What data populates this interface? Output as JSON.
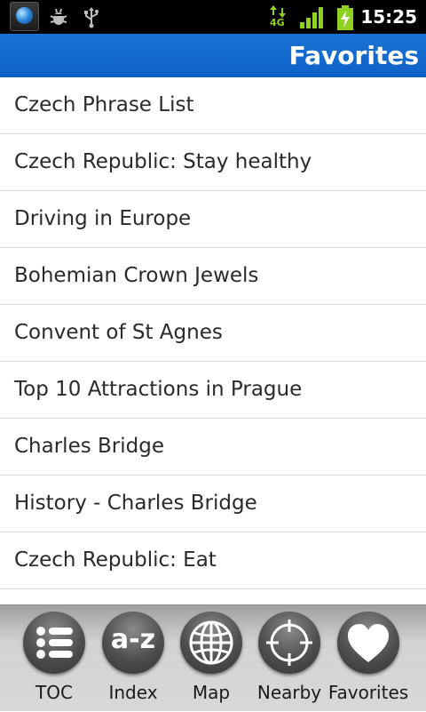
{
  "status_bar": {
    "time": "15:25",
    "network_type": "4G",
    "icons": [
      "app-globe-icon",
      "debug-bug-icon",
      "usb-icon",
      "data-transfer-icon",
      "signal-strength-icon",
      "battery-charging-icon"
    ]
  },
  "header": {
    "title": "Favorites"
  },
  "favorites": [
    {
      "label": "Czech Phrase List"
    },
    {
      "label": "Czech Republic: Stay healthy"
    },
    {
      "label": "Driving in Europe"
    },
    {
      "label": "Bohemian Crown Jewels"
    },
    {
      "label": "Convent of St Agnes"
    },
    {
      "label": "Top 10 Attractions in Prague"
    },
    {
      "label": "Charles Bridge"
    },
    {
      "label": "History - Charles Bridge"
    },
    {
      "label": "Czech Republic: Eat"
    }
  ],
  "toolbar": {
    "items": [
      {
        "label": "TOC",
        "icon": "list-icon"
      },
      {
        "label": "Index",
        "icon": "a-z-icon",
        "glyph": "a-z"
      },
      {
        "label": "Map",
        "icon": "globe-icon"
      },
      {
        "label": "Nearby",
        "icon": "crosshair-icon"
      },
      {
        "label": "Favorites",
        "icon": "heart-icon"
      }
    ]
  },
  "colors": {
    "title_bar": "#0d62c8",
    "status_bar": "#000000",
    "signal_green": "#8fd11e"
  }
}
